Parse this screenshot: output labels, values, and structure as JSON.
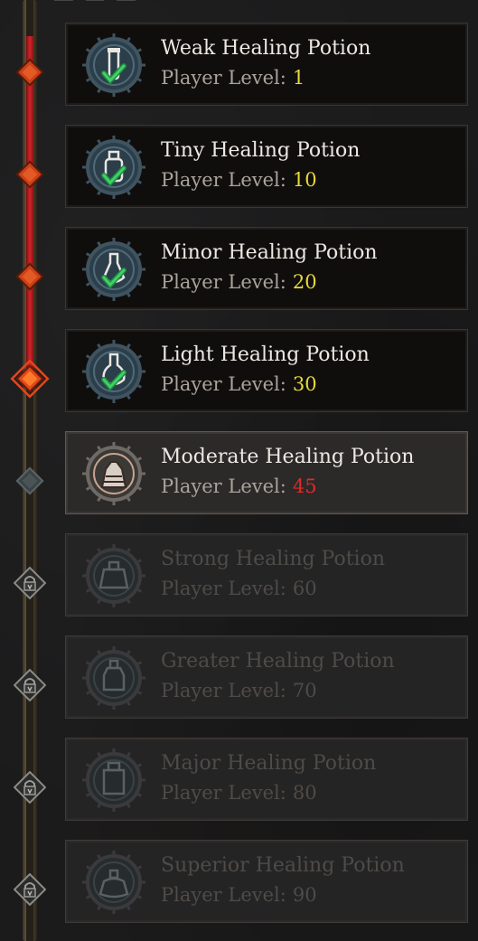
{
  "potions": [
    {
      "name": "Weak Healing Potion",
      "level_label": "Player Level:",
      "level": "1",
      "state": "unlocked",
      "icon": "weak-potion-icon"
    },
    {
      "name": "Tiny Healing Potion",
      "level_label": "Player Level:",
      "level": "10",
      "state": "unlocked",
      "icon": "tiny-potion-icon"
    },
    {
      "name": "Minor Healing Potion",
      "level_label": "Player Level:",
      "level": "20",
      "state": "unlocked",
      "icon": "minor-potion-icon"
    },
    {
      "name": "Light Healing Potion",
      "level_label": "Player Level:",
      "level": "30",
      "state": "unlocked",
      "icon": "light-potion-icon"
    },
    {
      "name": "Moderate Healing Potion",
      "level_label": "Player Level:",
      "level": "45",
      "state": "current",
      "icon": "moderate-potion-icon"
    },
    {
      "name": "Strong Healing Potion",
      "level_label": "Player Level:",
      "level": "60",
      "state": "locked",
      "icon": "strong-potion-icon"
    },
    {
      "name": "Greater Healing Potion",
      "level_label": "Player Level:",
      "level": "70",
      "state": "locked",
      "icon": "greater-potion-icon"
    },
    {
      "name": "Major Healing Potion",
      "level_label": "Player Level:",
      "level": "80",
      "state": "locked",
      "icon": "major-potion-icon"
    },
    {
      "name": "Superior Healing Potion",
      "level_label": "Player Level:",
      "level": "90",
      "state": "locked",
      "icon": "superior-potion-icon"
    }
  ],
  "colors": {
    "met_level": "#e8d83a",
    "unmet_level": "#e22929",
    "progress_fill": "#d2242a",
    "node_active": "#e2461c"
  },
  "progress": {
    "completed_nodes": 4,
    "current_node_index": 3,
    "total_nodes": 9
  }
}
